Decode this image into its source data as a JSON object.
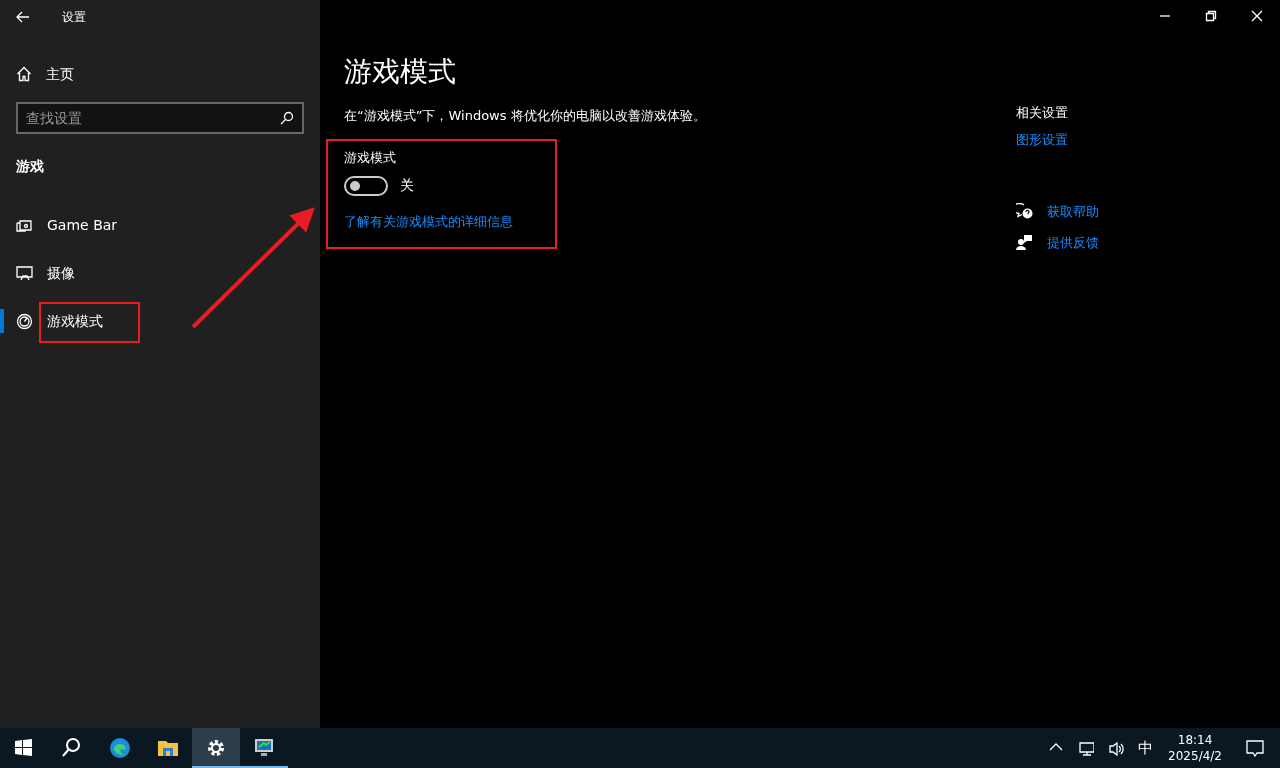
{
  "window": {
    "title": "设置"
  },
  "sidebar": {
    "home": "主页",
    "search": {
      "placeholder": "查找设置"
    },
    "section": "游戏",
    "items": [
      {
        "kind": "gamebar",
        "label": "Game Bar",
        "selected": false
      },
      {
        "kind": "capture",
        "label": "摄像",
        "selected": false
      },
      {
        "kind": "gamemode",
        "label": "游戏模式",
        "selected": true
      }
    ]
  },
  "main": {
    "title": "游戏模式",
    "description": "在“游戏模式”下，Windows 将优化你的电脑以改善游戏体验。",
    "setting": {
      "label": "游戏模式",
      "on": false,
      "state_text": "关"
    },
    "link": "了解有关游戏模式的详细信息"
  },
  "related": {
    "heading": "相关设置",
    "links": [
      "图形设置"
    ]
  },
  "support": [
    {
      "kind": "help",
      "label": "获取帮助"
    },
    {
      "kind": "feedback",
      "label": "提供反馈"
    }
  ],
  "taskbar": {
    "apps": [
      {
        "kind": "start",
        "selected": false,
        "running": false
      },
      {
        "kind": "search",
        "selected": false,
        "running": false
      },
      {
        "kind": "edge",
        "selected": false,
        "running": false
      },
      {
        "kind": "explorer",
        "selected": false,
        "running": false
      },
      {
        "kind": "settings",
        "selected": true,
        "running": true
      },
      {
        "kind": "monitor",
        "selected": false,
        "running": true
      }
    ],
    "ime": "中",
    "time": "18:14",
    "date": "2025/4/2"
  }
}
